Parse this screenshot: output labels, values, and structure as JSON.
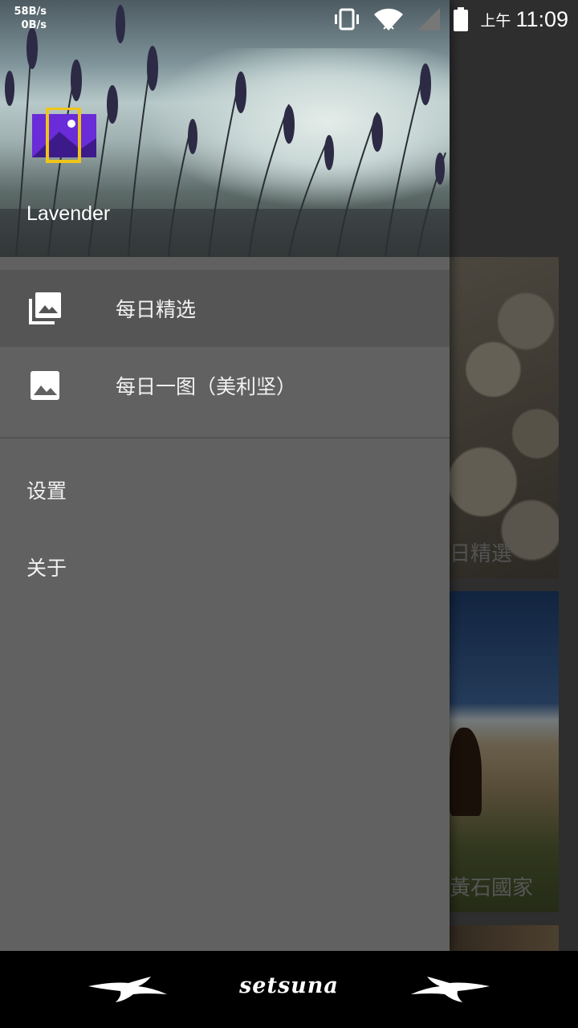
{
  "status_bar": {
    "net_up": "58B/s",
    "net_down": "0B/s",
    "ampm": "上午",
    "time": "11:09"
  },
  "drawer": {
    "app_name": "Lavender",
    "items": [
      {
        "label": "每日精选",
        "icon": "photo-library-icon",
        "active": true
      },
      {
        "label": "每日一图（美利坚）",
        "icon": "image-icon",
        "active": false
      }
    ],
    "settings_label": "设置",
    "about_label": "关于"
  },
  "background": {
    "card1_label": "日精選",
    "card2_label": "黃石國家"
  },
  "bottom_bar": {
    "brand": "setsuna"
  },
  "colors": {
    "drawer_bg": "#616161",
    "active_item_bg": "#555555",
    "logo_purple": "#6a2bd8",
    "logo_yellow": "#f0c419"
  }
}
